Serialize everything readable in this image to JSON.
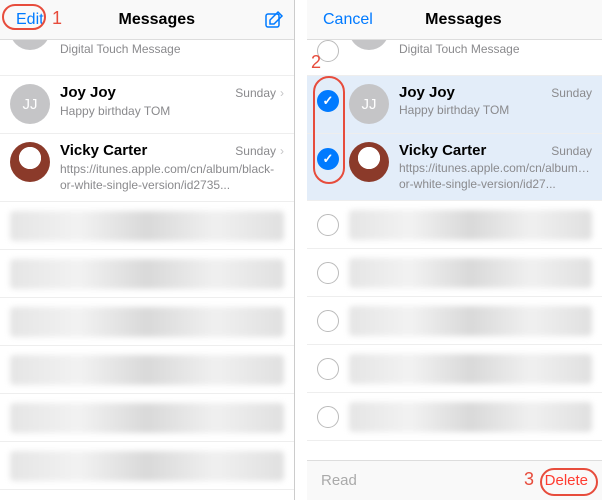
{
  "left": {
    "header": {
      "edit": "Edit",
      "title": "Messages"
    },
    "rows": [
      {
        "name": "",
        "preview": "Digital Touch Message",
        "time": "",
        "initials": ""
      },
      {
        "name": "Joy Joy",
        "preview": "Happy birthday TOM",
        "time": "Sunday",
        "initials": "JJ"
      },
      {
        "name": "Vicky Carter",
        "preview": "https://itunes.apple.com/cn/album/black-or-white-single-version/id2735...",
        "time": "Sunday",
        "initials": "cat"
      }
    ]
  },
  "right": {
    "header": {
      "cancel": "Cancel",
      "title": "Messages"
    },
    "rows": [
      {
        "name": "",
        "preview": "Digital Touch Message",
        "time": "",
        "initials": "",
        "checked": false
      },
      {
        "name": "Joy Joy",
        "preview": "Happy birthday TOM",
        "time": "Sunday",
        "initials": "JJ",
        "checked": true
      },
      {
        "name": "Vicky Carter",
        "preview": "https://itunes.apple.com/cn/album/black-or-white-single-version/id27...",
        "time": "Sunday",
        "initials": "cat",
        "checked": true
      }
    ],
    "toolbar": {
      "read": "Read",
      "delete": "Delete"
    }
  },
  "annotations": {
    "n1": "1",
    "n2": "2",
    "n3": "3"
  }
}
